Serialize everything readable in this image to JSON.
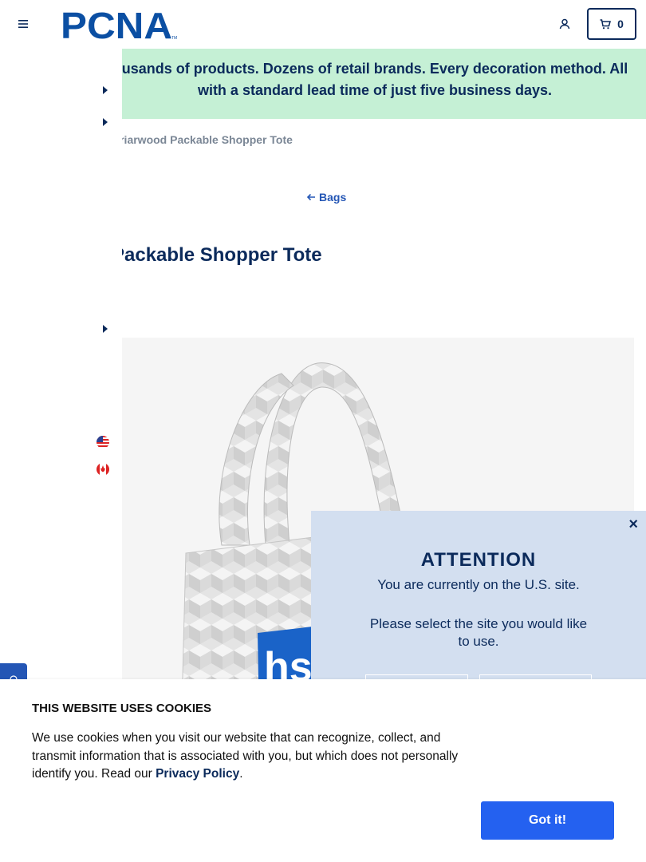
{
  "header": {
    "logo_text": "PCNA",
    "logo_tm": "TM",
    "cart_count": "0",
    "icons": [
      "menu-icon",
      "user-icon",
      "cart-icon"
    ]
  },
  "banner": {
    "text": "usands of products. Dozens of retail brands. Every decoration method. All with a standard lead time of just five business days."
  },
  "breadcrumb": {
    "current": "Briarwood Packable Shopper Tote"
  },
  "back_link": {
    "label": "Bags"
  },
  "product": {
    "title": "Packable Shopper Tote",
    "image_badge_text": "hs"
  },
  "attention": {
    "close_label": "×",
    "title": "ATTENTION",
    "message": "You are currently on the U.S. site.",
    "prompt": "Please select the site you would like to use."
  },
  "cookies": {
    "title": "THIS WEBSITE USES COOKIES",
    "body": "We use cookies when you visit our website that can recognize, collect, and transmit information that is associated with you, but which does not personally identify you. Read our ",
    "link": "Privacy Policy",
    "period": ".",
    "accept_label": "Got it!"
  },
  "colors": {
    "navy": "#0b2a5b",
    "banner_green": "#c5f0d5",
    "modal_blue": "#d3dff0",
    "accent_blue": "#2461f0"
  }
}
